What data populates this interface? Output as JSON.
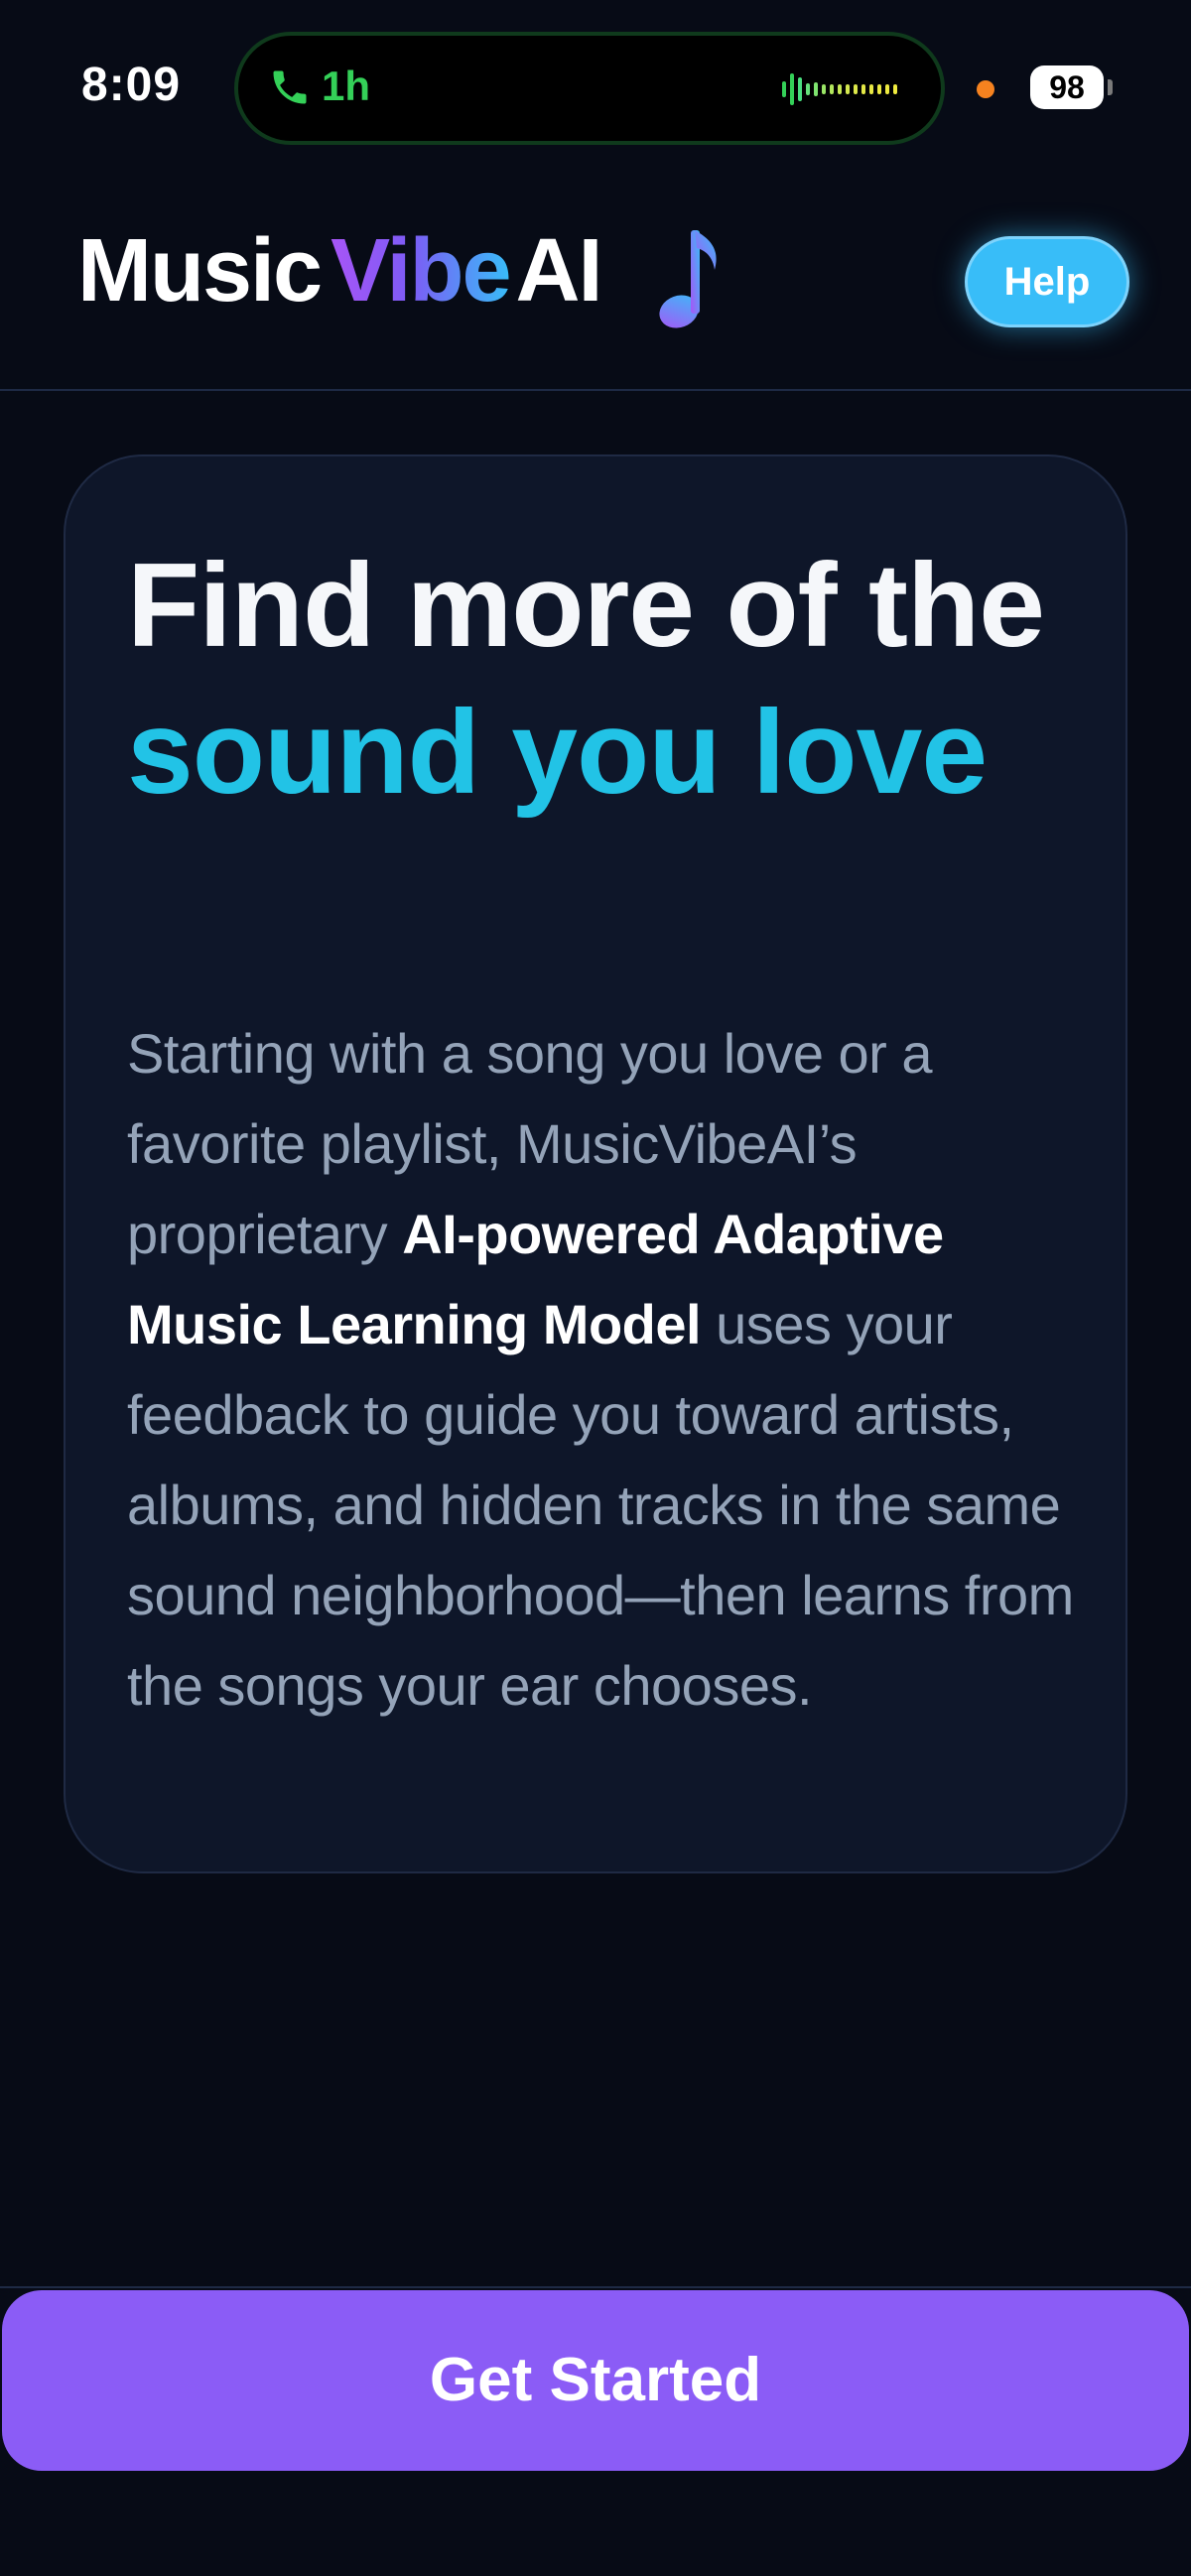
{
  "status_bar": {
    "time": "8:09",
    "call_duration": "1h",
    "battery": "98"
  },
  "header": {
    "logo": {
      "part1": "Music",
      "part2": "Vibe",
      "part3": "AI"
    },
    "help_label": "Help"
  },
  "hero": {
    "title_plain_1": "Find more of the ",
    "title_accent": "sound you love",
    "body_1": "Starting with a song you love or a favorite playlist, MusicVibeAI’s proprietary ",
    "body_bold": "AI-powered Adaptive Music Learning Model",
    "body_2": " uses your feedback to guide you toward artists, albums, and hidden tracks in the same sound neighborhood—then learns from the songs your ear chooses."
  },
  "cta": {
    "label": "Get Started"
  },
  "colors": {
    "background": "#070b16",
    "card": "#0e1629",
    "accent_cyan": "#22c3e6",
    "help_blue": "#38bdf8",
    "cta_purple": "#8b5cf6",
    "call_green": "#34d058"
  },
  "icons": {
    "call": "phone-icon",
    "audio": "waveform-icon",
    "logo": "music-note-icon"
  }
}
